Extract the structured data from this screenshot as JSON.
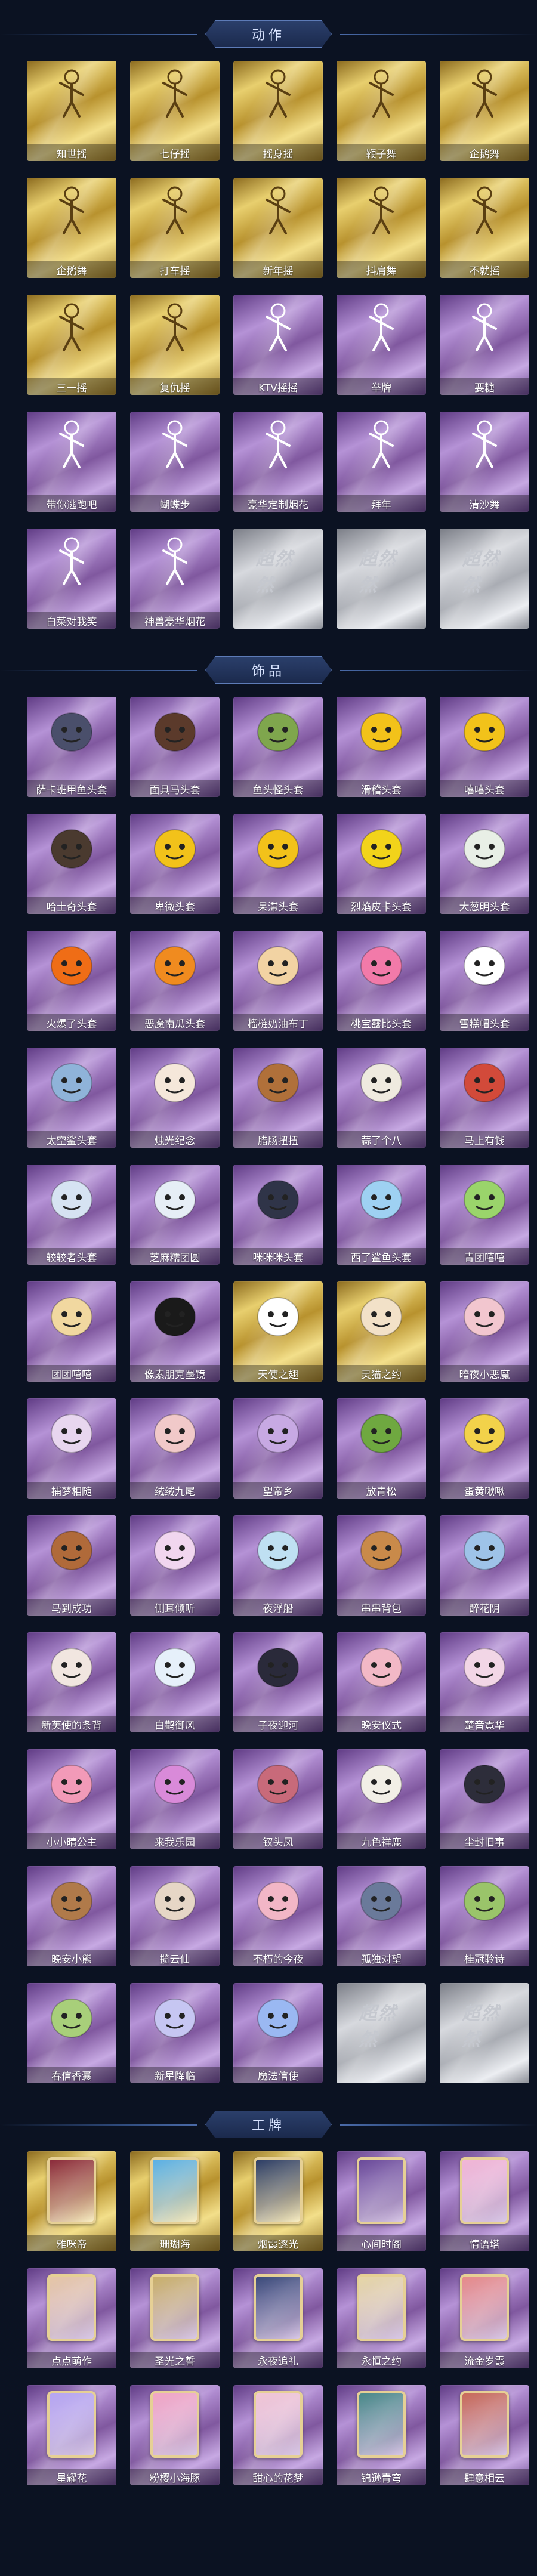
{
  "sections": {
    "actions": {
      "title": "动作"
    },
    "accessories": {
      "title": "饰品"
    },
    "badges": {
      "title": "工牌"
    }
  },
  "actions": [
    {
      "label": "知世摇",
      "rarity": "gold",
      "icon": "figure-icon"
    },
    {
      "label": "七仔摇",
      "rarity": "gold",
      "icon": "figure-icon"
    },
    {
      "label": "摇身摇",
      "rarity": "gold",
      "icon": "figure-icon"
    },
    {
      "label": "鞭子舞",
      "rarity": "gold",
      "icon": "figure-icon"
    },
    {
      "label": "企鹅舞",
      "rarity": "gold",
      "icon": "figure-icon"
    },
    {
      "label": "企鹅舞",
      "rarity": "gold",
      "icon": "figure-icon"
    },
    {
      "label": "打车摇",
      "rarity": "gold",
      "icon": "figure-icon"
    },
    {
      "label": "新年摇",
      "rarity": "gold",
      "icon": "figure-icon"
    },
    {
      "label": "抖肩舞",
      "rarity": "gold",
      "icon": "figure-icon"
    },
    {
      "label": "不就摇",
      "rarity": "gold",
      "icon": "figure-icon"
    },
    {
      "label": "三一摇",
      "rarity": "gold",
      "icon": "figure-icon"
    },
    {
      "label": "复仇摇",
      "rarity": "gold",
      "icon": "figure-icon"
    },
    {
      "label": "KTV摇摇",
      "rarity": "purple",
      "icon": "figure-icon"
    },
    {
      "label": "举牌",
      "rarity": "purple",
      "icon": "figure-icon"
    },
    {
      "label": "要糖",
      "rarity": "purple",
      "icon": "figure-icon"
    },
    {
      "label": "带你逃跑吧",
      "rarity": "purple",
      "icon": "figure-icon"
    },
    {
      "label": "蝴蝶步",
      "rarity": "purple",
      "icon": "figure-icon"
    },
    {
      "label": "豪华定制烟花",
      "rarity": "purple",
      "icon": "figure-icon"
    },
    {
      "label": "拜年",
      "rarity": "purple",
      "icon": "figure-icon"
    },
    {
      "label": "清沙舞",
      "rarity": "purple",
      "icon": "figure-icon"
    },
    {
      "label": "白菜对我笑",
      "rarity": "purple",
      "icon": "figure-icon"
    },
    {
      "label": "神兽豪华烟花",
      "rarity": "purple",
      "icon": "figure-icon"
    },
    {
      "label": "",
      "rarity": "silver",
      "icon": "placeholder-logo"
    },
    {
      "label": "",
      "rarity": "silver",
      "icon": "placeholder-logo"
    },
    {
      "label": "",
      "rarity": "silver",
      "icon": "placeholder-logo"
    }
  ],
  "accessories": [
    {
      "label": "萨卡班甲鱼头套",
      "rarity": "purple",
      "color": "#4a4f6b"
    },
    {
      "label": "面具马头套",
      "rarity": "purple",
      "color": "#5b3a2b"
    },
    {
      "label": "鱼头怪头套",
      "rarity": "purple",
      "color": "#7fa64d"
    },
    {
      "label": "滑稽头套",
      "rarity": "purple",
      "color": "#f2c21a"
    },
    {
      "label": "嘻嘻头套",
      "rarity": "purple",
      "color": "#f2c21a"
    },
    {
      "label": "哈士奇头套",
      "rarity": "purple",
      "color": "#4a3a2f"
    },
    {
      "label": "卑微头套",
      "rarity": "purple",
      "color": "#f2c21a"
    },
    {
      "label": "呆滞头套",
      "rarity": "purple",
      "color": "#f2c21a"
    },
    {
      "label": "烈焰皮卡头套",
      "rarity": "purple",
      "color": "#f2d31a"
    },
    {
      "label": "大葱明头套",
      "rarity": "purple",
      "color": "#e8efe6"
    },
    {
      "label": "火爆了头套",
      "rarity": "purple",
      "color": "#ef6d16"
    },
    {
      "label": "恶魔南瓜头套",
      "rarity": "purple",
      "color": "#f08b1f"
    },
    {
      "label": "榴梿奶油布丁",
      "rarity": "purple",
      "color": "#f2d3a3"
    },
    {
      "label": "桃宝露比头套",
      "rarity": "purple",
      "color": "#f27aa9"
    },
    {
      "label": "雪糕帽头套",
      "rarity": "purple",
      "color": "#ffffff"
    },
    {
      "label": "太空鲨头套",
      "rarity": "purple",
      "color": "#8fb3d9"
    },
    {
      "label": "烛光纪念",
      "rarity": "purple",
      "color": "#f5e7da"
    },
    {
      "label": "腊肠扭扭",
      "rarity": "purple",
      "color": "#b0703a"
    },
    {
      "label": "蒜了个八",
      "rarity": "purple",
      "color": "#efeadf"
    },
    {
      "label": "马上有钱",
      "rarity": "purple",
      "color": "#d24a3a"
    },
    {
      "label": "较较者头套",
      "rarity": "purple",
      "color": "#d6e3f2"
    },
    {
      "label": "芝麻糯团圆",
      "rarity": "purple",
      "color": "#e6eef6"
    },
    {
      "label": "咪咪咪头套",
      "rarity": "purple",
      "color": "#2f3448"
    },
    {
      "label": "西了鲨鱼头套",
      "rarity": "purple",
      "color": "#9ed1f2"
    },
    {
      "label": "青团嘻嘻",
      "rarity": "purple",
      "color": "#9ad46b"
    },
    {
      "label": "团团嘻嘻",
      "rarity": "purple",
      "color": "#f1d8a0"
    },
    {
      "label": "像素朋克墨镜",
      "rarity": "purple",
      "color": "#1a1a1a"
    },
    {
      "label": "天使之翅",
      "rarity": "gold",
      "color": "#ffffff"
    },
    {
      "label": "灵猫之约",
      "rarity": "gold",
      "color": "#f2e1c8"
    },
    {
      "label": "暗夜小恶魔",
      "rarity": "purple",
      "color": "#f2c6cf"
    },
    {
      "label": "捕梦相随",
      "rarity": "purple",
      "color": "#e8d6ef"
    },
    {
      "label": "绒绒九尾",
      "rarity": "purple",
      "color": "#f1c9c9"
    },
    {
      "label": "望帝乡",
      "rarity": "purple",
      "color": "#c7a9e3"
    },
    {
      "label": "放青松",
      "rarity": "purple",
      "color": "#6fa840"
    },
    {
      "label": "蛋黄啾啾",
      "rarity": "purple",
      "color": "#f2d24a"
    },
    {
      "label": "马到成功",
      "rarity": "purple",
      "color": "#b06a3a"
    },
    {
      "label": "侧耳倾听",
      "rarity": "purple",
      "color": "#f1d6ef"
    },
    {
      "label": "夜浮船",
      "rarity": "purple",
      "color": "#bfe0f2"
    },
    {
      "label": "串串背包",
      "rarity": "purple",
      "color": "#c98a4a"
    },
    {
      "label": "醉花阴",
      "rarity": "purple",
      "color": "#9ec3e8"
    },
    {
      "label": "新芙使的条背",
      "rarity": "purple",
      "color": "#f1e6e0"
    },
    {
      "label": "白鹳御风",
      "rarity": "purple",
      "color": "#e6f0fa"
    },
    {
      "label": "子夜迎河",
      "rarity": "purple",
      "color": "#2a2a3a"
    },
    {
      "label": "晚安仪式",
      "rarity": "purple",
      "color": "#f2b8c6"
    },
    {
      "label": "楚音霓华",
      "rarity": "purple",
      "color": "#f2d6e6"
    },
    {
      "label": "小小晴公主",
      "rarity": "purple",
      "color": "#f29ab8"
    },
    {
      "label": "来我乐园",
      "rarity": "purple",
      "color": "#d98ad9"
    },
    {
      "label": "钗头凤",
      "rarity": "purple",
      "color": "#c86a7a"
    },
    {
      "label": "九色祥鹿",
      "rarity": "purple",
      "color": "#f2efe6"
    },
    {
      "label": "尘封旧事",
      "rarity": "purple",
      "color": "#2d2d3a"
    },
    {
      "label": "晚安小熊",
      "rarity": "purple",
      "color": "#b07a4a"
    },
    {
      "label": "揽云仙",
      "rarity": "purple",
      "color": "#e6d6c6"
    },
    {
      "label": "不朽的今夜",
      "rarity": "purple",
      "color": "#f2b6c6"
    },
    {
      "label": "孤独对望",
      "rarity": "purple",
      "color": "#6a7a9a"
    },
    {
      "label": "桂冠聆诗",
      "rarity": "purple",
      "color": "#9ac46a"
    },
    {
      "label": "春信香囊",
      "rarity": "purple",
      "color": "#a8cf7a"
    },
    {
      "label": "新星降临",
      "rarity": "purple",
      "color": "#c6c6f2"
    },
    {
      "label": "魔法信使",
      "rarity": "purple",
      "color": "#9ab8f2"
    },
    {
      "label": "",
      "rarity": "silver",
      "color": ""
    },
    {
      "label": "",
      "rarity": "silver",
      "color": ""
    }
  ],
  "badges": [
    {
      "label": "雅咪帝",
      "rarity": "gold",
      "color": "#8a2a3a"
    },
    {
      "label": "珊瑚海",
      "rarity": "gold",
      "color": "#5ab0e6"
    },
    {
      "label": "烟霞逐光",
      "rarity": "gold",
      "color": "#2c3d66"
    },
    {
      "label": "心间时阁",
      "rarity": "purple",
      "color": "#6a4a9a"
    },
    {
      "label": "情语塔",
      "rarity": "purple",
      "color": "#f2b6d6"
    },
    {
      "label": "点点萌作",
      "rarity": "purple",
      "color": "#e6c6a6"
    },
    {
      "label": "圣光之誓",
      "rarity": "purple",
      "color": "#c9b06a"
    },
    {
      "label": "永夜追礼",
      "rarity": "purple",
      "color": "#3a4a7a"
    },
    {
      "label": "永恒之约",
      "rarity": "purple",
      "color": "#e6d6a6"
    },
    {
      "label": "流金岁霞",
      "rarity": "purple",
      "color": "#e68a8a"
    },
    {
      "label": "星耀花",
      "rarity": "purple",
      "color": "#b6a6f2"
    },
    {
      "label": "粉樱小海豚",
      "rarity": "purple",
      "color": "#f2a6c6"
    },
    {
      "label": "甜心的花梦",
      "rarity": "purple",
      "color": "#f2c6d6"
    },
    {
      "label": "锦逊青穹",
      "rarity": "purple",
      "color": "#4a8a8a"
    },
    {
      "label": "肆意相云",
      "rarity": "purple",
      "color": "#c86a5a"
    }
  ],
  "placeholder_text": "超然然"
}
